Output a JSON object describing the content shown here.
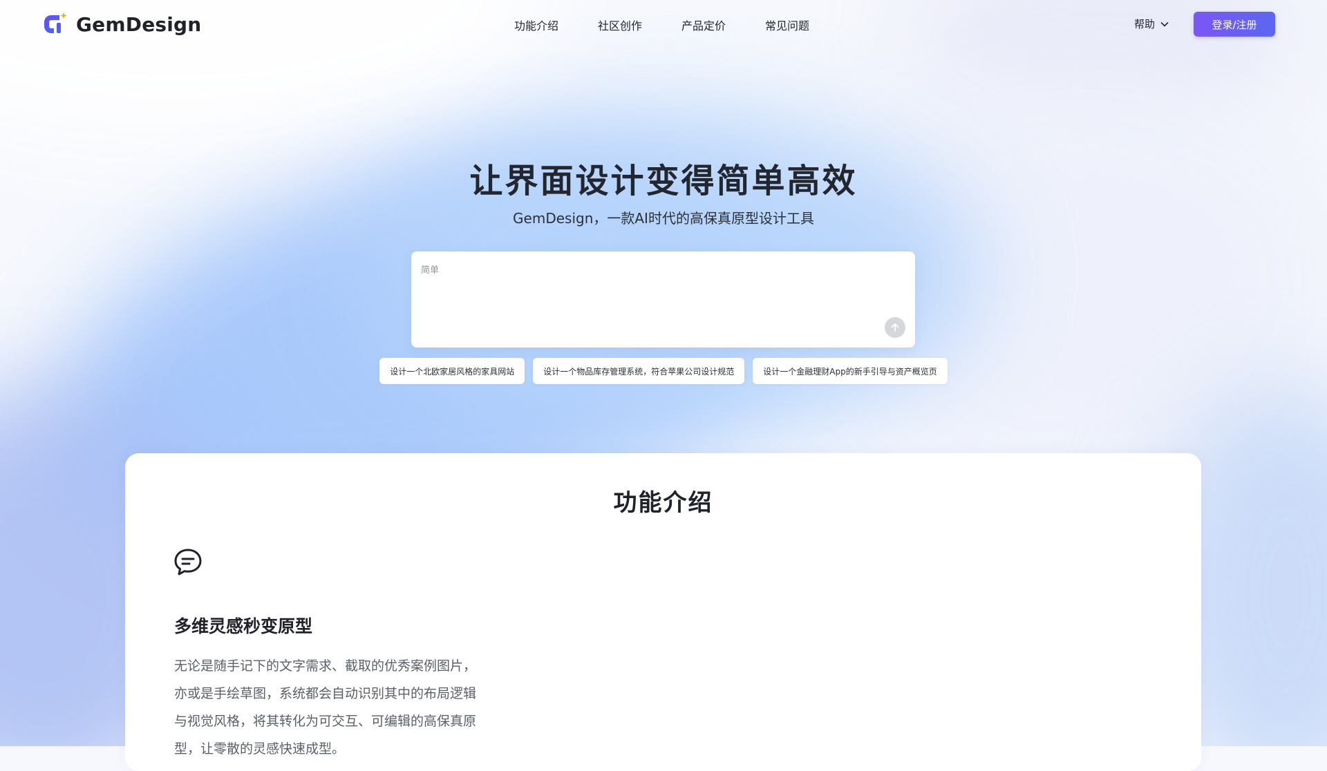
{
  "brand": {
    "name": "GemDesign",
    "accent_color": "#5b4ff0",
    "spark_color": "#f5a623",
    "button_gradient": [
      "#7b55f6",
      "#5b67f0"
    ]
  },
  "nav": {
    "items": [
      {
        "label": "功能介绍"
      },
      {
        "label": "社区创作"
      },
      {
        "label": "产品定价"
      },
      {
        "label": "常见问题"
      }
    ],
    "help_label": "帮助",
    "login_label": "登录/注册"
  },
  "hero": {
    "title": "让界面设计变得简单高效",
    "subtitle": "GemDesign，一款AI时代的高保真原型设计工具",
    "prompt_placeholder": "简单",
    "suggestions": [
      "设计一个北欧家居风格的家具网站",
      "设计一个物品库存管理系统，符合苹果公司设计规范",
      "设计一个金融理财App的新手引导与资产概览页"
    ]
  },
  "features": {
    "section_title": "功能介绍",
    "items": [
      {
        "icon": "chat-bubble-icon",
        "title": "多维灵感秒变原型",
        "description": "无论是随手记下的文字需求、截取的优秀案例图片，亦或是手绘草图，系统都会自动识别其中的布局逻辑与视觉风格，将其转化为可交互、可编辑的高保真原型，让零散的灵感快速成型。"
      }
    ]
  }
}
